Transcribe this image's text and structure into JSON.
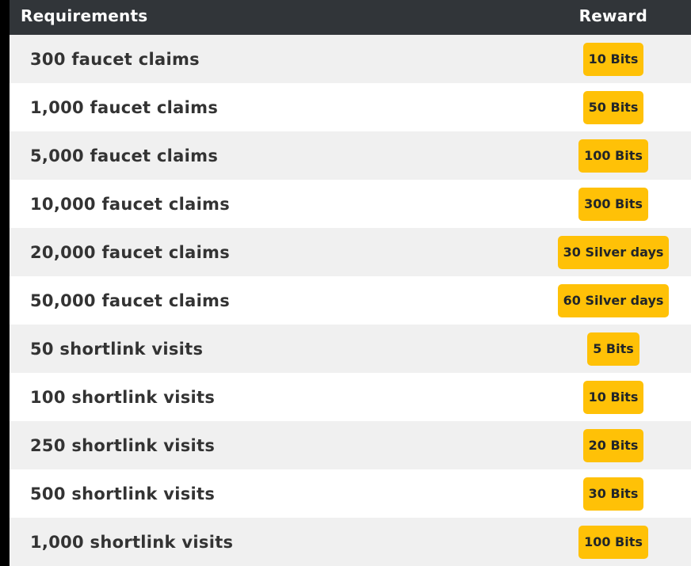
{
  "table": {
    "header": {
      "requirements": "Requirements",
      "reward": "Reward"
    },
    "rows": [
      {
        "requirement": "300 faucet claims",
        "reward": "10 Bits"
      },
      {
        "requirement": "1,000 faucet claims",
        "reward": "50 Bits"
      },
      {
        "requirement": "5,000 faucet claims",
        "reward": "100 Bits"
      },
      {
        "requirement": "10,000 faucet claims",
        "reward": "300 Bits"
      },
      {
        "requirement": "20,000 faucet claims",
        "reward": "30 Silver days"
      },
      {
        "requirement": "50,000 faucet claims",
        "reward": "60 Silver days"
      },
      {
        "requirement": "50 shortlink visits",
        "reward": "5 Bits"
      },
      {
        "requirement": "100 shortlink visits",
        "reward": "10 Bits"
      },
      {
        "requirement": "250 shortlink visits",
        "reward": "20 Bits"
      },
      {
        "requirement": "500 shortlink visits",
        "reward": "30 Bits"
      },
      {
        "requirement": "1,000 shortlink visits",
        "reward": "100 Bits"
      }
    ]
  },
  "colors": {
    "header_bg": "#313539",
    "row_alt_bg": "#f0f0f0",
    "badge_bg": "#ffc107",
    "text": "#333333"
  }
}
